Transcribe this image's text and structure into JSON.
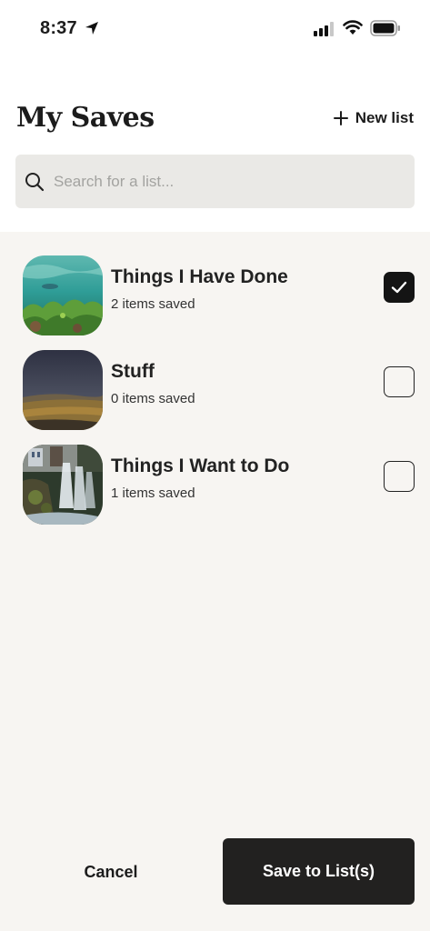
{
  "status_bar": {
    "time": "8:37",
    "icons": [
      "location-arrow-icon",
      "cellular-signal-icon",
      "wifi-icon",
      "battery-icon"
    ]
  },
  "header": {
    "title": "My Saves",
    "new_list_label": "New list"
  },
  "search": {
    "placeholder": "Search for a list..."
  },
  "lists": [
    {
      "title": "Things I Have Done",
      "count_label": "2 items saved",
      "checked": true
    },
    {
      "title": "Stuff",
      "count_label": "0 items saved",
      "checked": false
    },
    {
      "title": "Things I Want to Do",
      "count_label": "1 items saved",
      "checked": false
    }
  ],
  "footer": {
    "cancel_label": "Cancel",
    "save_label": "Save to List(s)"
  },
  "colors": {
    "background": "#ffffff",
    "list_background": "#f7f5f2",
    "search_background": "#eae9e6",
    "primary_button": "#222120",
    "text": "#1c1c1c"
  }
}
